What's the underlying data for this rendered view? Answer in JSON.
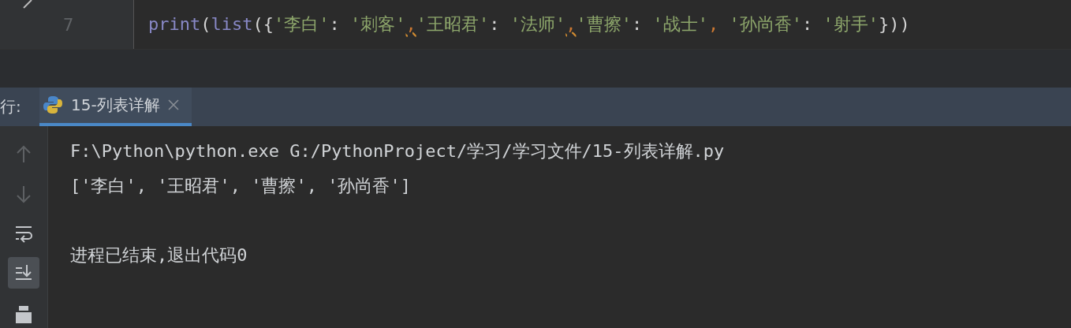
{
  "editor": {
    "line_number": "7",
    "tokens": [
      {
        "text": "print",
        "kind": "builtin"
      },
      {
        "text": "(",
        "kind": "punct"
      },
      {
        "text": "list",
        "kind": "builtin"
      },
      {
        "text": "({",
        "kind": "punct"
      },
      {
        "text": "'李白'",
        "kind": "string"
      },
      {
        "text": ": ",
        "kind": "punct"
      },
      {
        "text": "'刺客'",
        "kind": "string"
      },
      {
        "text": ",",
        "kind": "warning"
      },
      {
        "text": "'王昭君'",
        "kind": "string"
      },
      {
        "text": ": ",
        "kind": "punct"
      },
      {
        "text": "'法师'",
        "kind": "string"
      },
      {
        "text": ",",
        "kind": "warning"
      },
      {
        "text": "'曹擦'",
        "kind": "string"
      },
      {
        "text": ": ",
        "kind": "punct"
      },
      {
        "text": "'战士'",
        "kind": "string"
      },
      {
        "text": ", ",
        "kind": "comma"
      },
      {
        "text": "'孙尚香'",
        "kind": "string"
      },
      {
        "text": ": ",
        "kind": "punct"
      },
      {
        "text": "'射手'",
        "kind": "string"
      },
      {
        "text": "}))",
        "kind": "punct"
      }
    ]
  },
  "run_panel": {
    "label": "行:",
    "tabs": [
      {
        "label": "15-列表详解",
        "selected": true
      }
    ],
    "tools": [
      {
        "kind": "up",
        "disabled": true,
        "selected": false
      },
      {
        "kind": "down",
        "disabled": true,
        "selected": false
      },
      {
        "kind": "wrap",
        "disabled": false,
        "selected": false
      },
      {
        "kind": "scroll-end",
        "disabled": false,
        "selected": true
      },
      {
        "kind": "print",
        "disabled": false,
        "selected": false
      }
    ],
    "output": [
      {
        "kind": "text",
        "text": "F:\\Python\\python.exe G:/PythonProject/学习/学习文件/15-列表详解.py"
      },
      {
        "kind": "text",
        "text": "['李白', '王昭君', '曹擦', '孙尚香']"
      },
      {
        "kind": "blank"
      },
      {
        "kind": "text",
        "text": "进程已结束,退出代码0"
      }
    ]
  }
}
